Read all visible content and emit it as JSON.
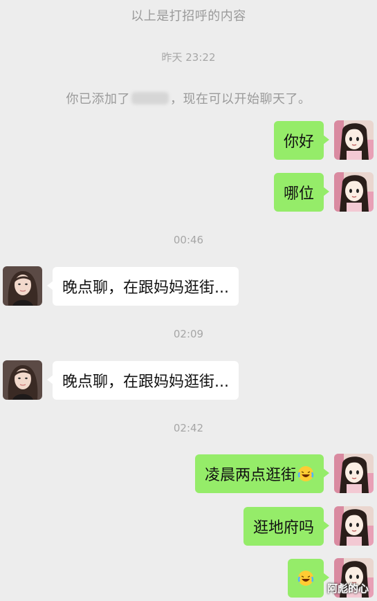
{
  "system": {
    "greeting_note": "以上是打招呼的内容",
    "added_prefix": "你已添加了",
    "added_suffix": "，现在可以开始聊天了。"
  },
  "timestamps": [
    "昨天 23:22",
    "00:46",
    "02:09",
    "02:42"
  ],
  "messages": [
    {
      "sender": "me",
      "text": "你好"
    },
    {
      "sender": "me",
      "text": "哪位"
    },
    {
      "sender": "them",
      "text": "晚点聊，在跟妈妈逛街..."
    },
    {
      "sender": "them",
      "text": "晚点聊，在跟妈妈逛街..."
    },
    {
      "sender": "me",
      "text": "凌晨两点逛街",
      "emoji": "laugh-cry-emoji"
    },
    {
      "sender": "me",
      "text": "逛地府吗"
    },
    {
      "sender": "me",
      "text": "",
      "emoji": "laugh-cry-emoji"
    }
  ],
  "watermark": "阿彪的心",
  "colors": {
    "background": "#ededed",
    "my_bubble": "#95ec69",
    "their_bubble": "#ffffff"
  }
}
